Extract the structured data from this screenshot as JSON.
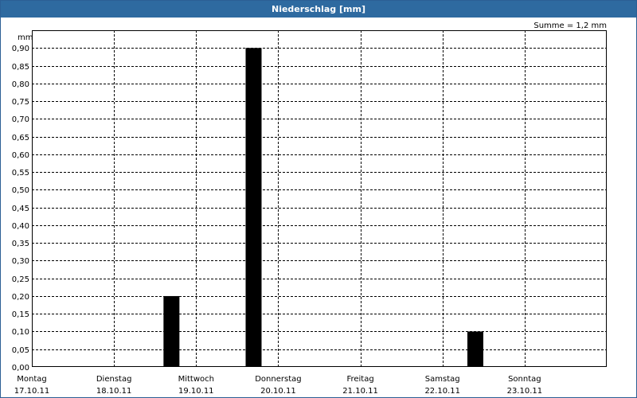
{
  "window": {
    "title": "Niederschlag [mm]"
  },
  "chart_data": {
    "type": "bar",
    "title": "Niederschlag [mm]",
    "unit_label": "mm",
    "summary": "Summe = 1,2 mm",
    "categories": [
      {
        "day": "Montag",
        "date": "17.10.11"
      },
      {
        "day": "Dienstag",
        "date": "18.10.11"
      },
      {
        "day": "Mittwoch",
        "date": "19.10.11"
      },
      {
        "day": "Donnerstag",
        "date": "20.10.11"
      },
      {
        "day": "Freitag",
        "date": "21.10.11"
      },
      {
        "day": "Samstag",
        "date": "22.10.11"
      },
      {
        "day": "Sonntag",
        "date": "23.10.11"
      }
    ],
    "bars": [
      {
        "x": 1.7,
        "value": 0.2
      },
      {
        "x": 2.7,
        "value": 0.9
      },
      {
        "x": 5.4,
        "value": 0.1
      }
    ],
    "xlim": [
      0,
      7
    ],
    "ylim": [
      0,
      0.95
    ],
    "yticks": [
      "0,00",
      "0,05",
      "0,10",
      "0,15",
      "0,20",
      "0,25",
      "0,30",
      "0,35",
      "0,40",
      "0,45",
      "0,50",
      "0,55",
      "0,60",
      "0,65",
      "0,70",
      "0,75",
      "0,80",
      "0,85",
      "0,90"
    ],
    "grid": true,
    "bar_color": "#000000"
  },
  "colors": {
    "title_bar": "#2e6aa0",
    "title_text": "#ffffff",
    "grid": "#000000"
  }
}
